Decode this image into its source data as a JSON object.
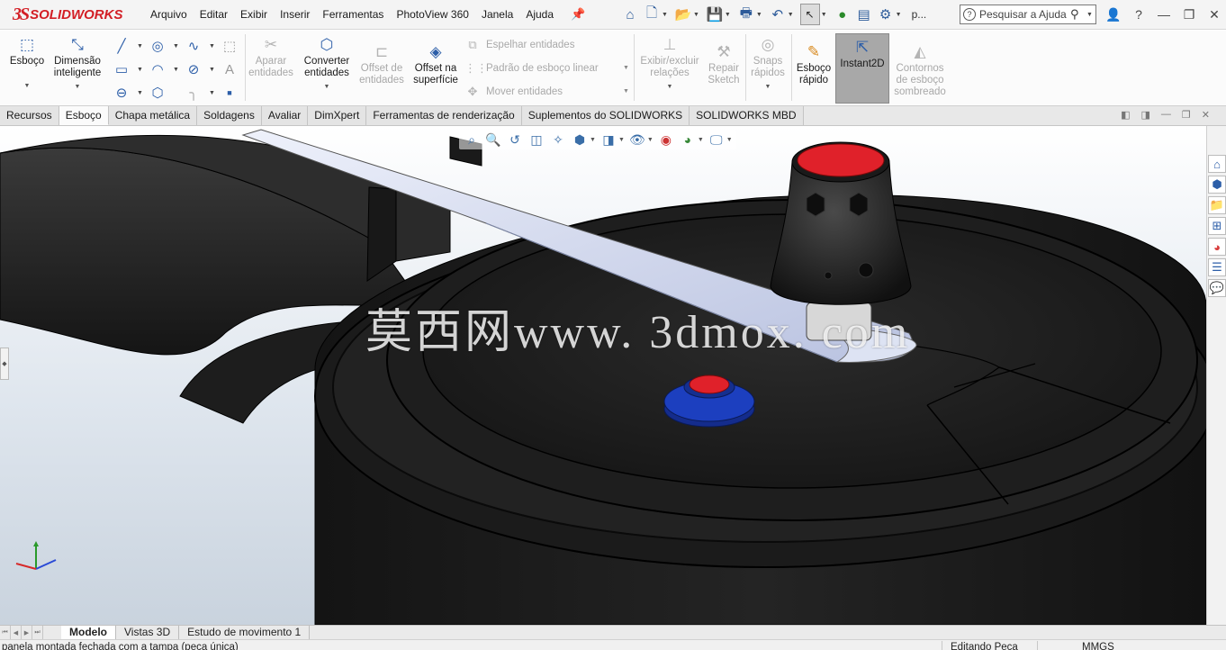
{
  "app": {
    "brand": "SOLIDWORKS",
    "menu": [
      "Arquivo",
      "Editar",
      "Exibir",
      "Inserir",
      "Ferramentas",
      "PhotoView 360",
      "Janela",
      "Ajuda"
    ],
    "quick_label": "p...",
    "search_placeholder": "Pesquisar a Ajuda"
  },
  "ribbon": {
    "esboco": "Esboço",
    "dimensao": [
      "Dimensão",
      "inteligente"
    ],
    "aparar": [
      "Aparar",
      "entidades"
    ],
    "converter": [
      "Converter",
      "entidades"
    ],
    "offset_entidades": [
      "Offset de",
      "entidades"
    ],
    "offset_superficie": [
      "Offset na",
      "superfície"
    ],
    "espelhar": "Espelhar entidades",
    "padrao": "Padrão de esboço linear",
    "mover": "Mover entidades",
    "exibir_relacoes": [
      "Exibir/excluir",
      "relações"
    ],
    "repair": [
      "Repair",
      "Sketch"
    ],
    "snaps": [
      "Snaps",
      "rápidos"
    ],
    "esboco_rapido": [
      "Esboço",
      "rápido"
    ],
    "instant2d": "Instant2D",
    "contornos": [
      "Contornos",
      "de esboço",
      "sombreado"
    ]
  },
  "tabs": [
    "Recursos",
    "Esboço",
    "Chapa metálica",
    "Soldagens",
    "Avaliar",
    "DimXpert",
    "Ferramentas de renderização",
    "Suplementos do SOLIDWORKS",
    "SOLIDWORKS MBD"
  ],
  "active_tab": "Esboço",
  "viewport": {
    "watermark": "莫西网www. 3dmox. com"
  },
  "bottom_tabs": [
    "Modelo",
    "Vistas 3D",
    "Estudo de movimento 1"
  ],
  "status": {
    "document": "panela montada fechada com a tampa (peça única)",
    "mode": "Editando Peça",
    "units": "MMGS"
  },
  "colors": {
    "brand": "#d31e25",
    "accent": "#2c5ea8",
    "knob_red": "#e0212a",
    "button_blue": "#1c3fbf",
    "blade": "#c8d0ea"
  }
}
